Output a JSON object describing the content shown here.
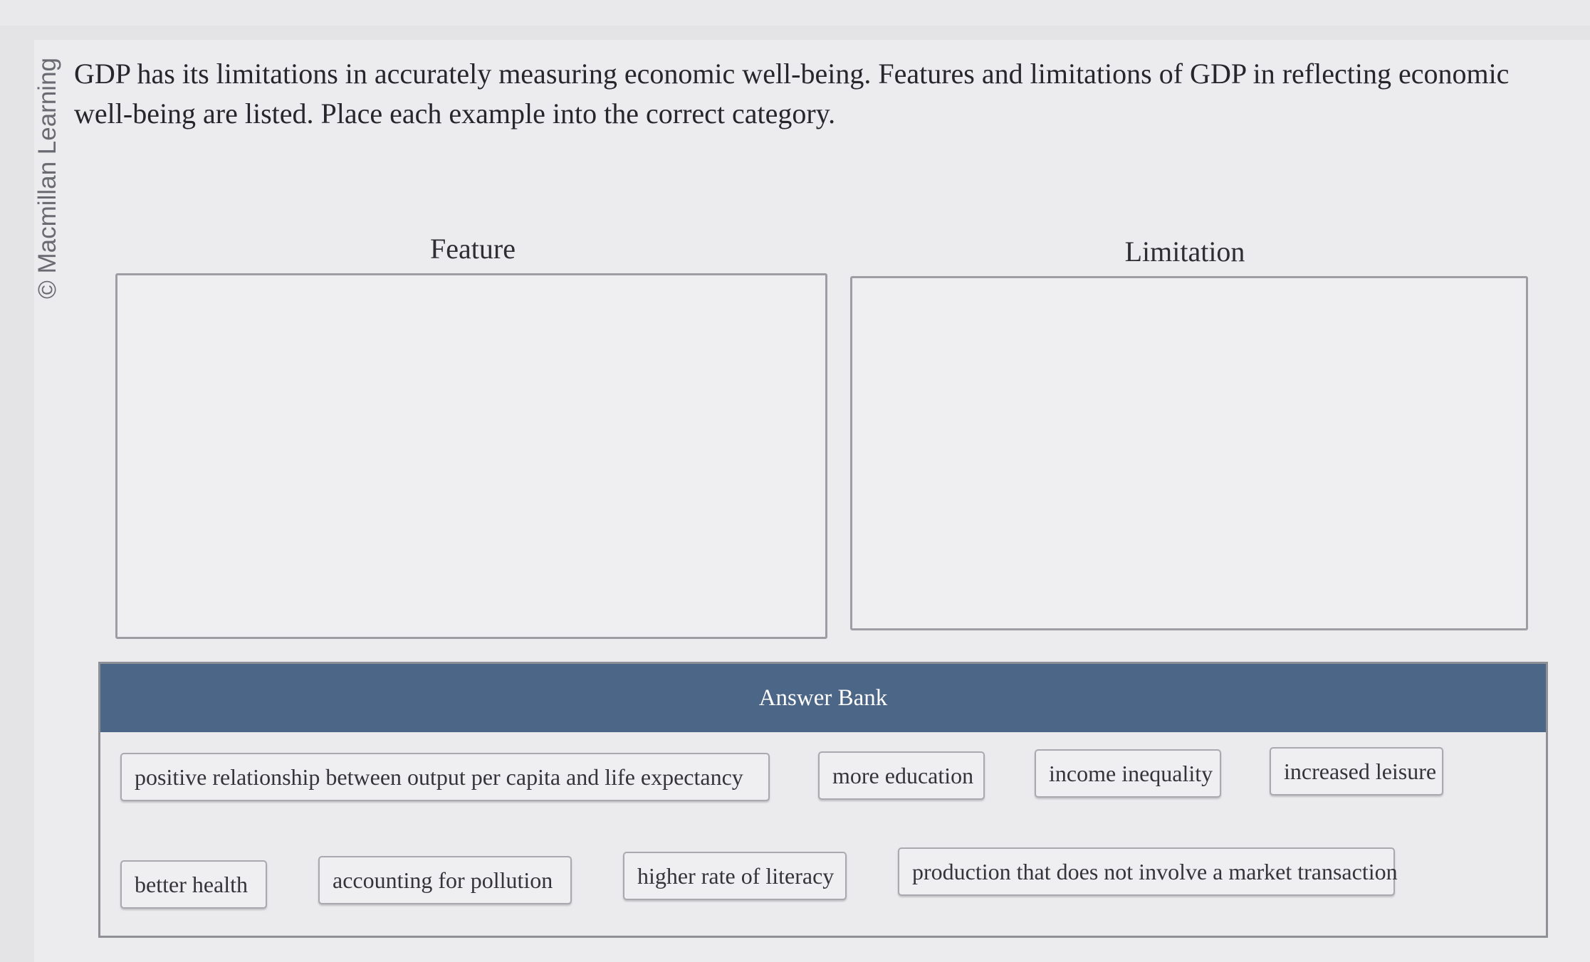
{
  "question": {
    "text": "GDP has its limitations in accurately measuring economic well-being. Features and limitations of GDP in reflecting economic well-being are listed. Place each example into the correct category."
  },
  "watermark": {
    "text": "© Macmillan Learning"
  },
  "categories": [
    {
      "label": "Feature"
    },
    {
      "label": "Limitation"
    }
  ],
  "answer_bank": {
    "title": "Answer Bank",
    "items": [
      {
        "label": "positive relationship between output per capita and life expectancy"
      },
      {
        "label": "more education"
      },
      {
        "label": "income inequality"
      },
      {
        "label": "increased leisure"
      },
      {
        "label": "better health"
      },
      {
        "label": "accounting for pollution"
      },
      {
        "label": "higher rate of literacy"
      },
      {
        "label": "production that does not involve a market transaction"
      }
    ]
  },
  "colors": {
    "bank_header": "#4c6688",
    "background": "#e4e4e6"
  }
}
